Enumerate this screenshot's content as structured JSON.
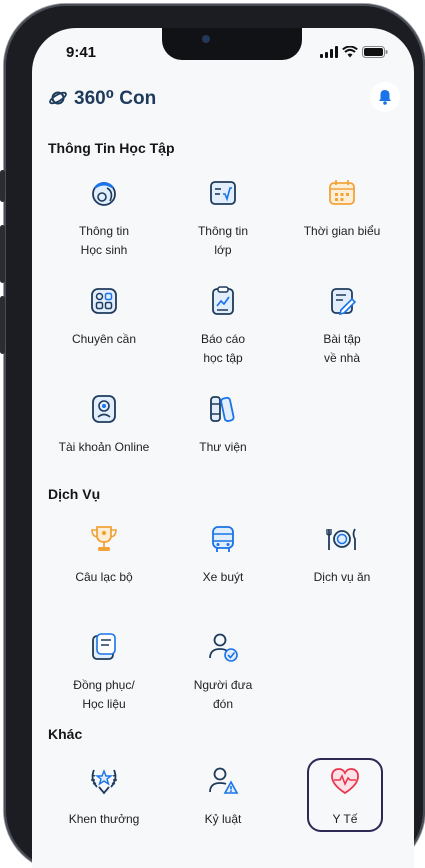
{
  "status_bar": {
    "time": "9:41"
  },
  "header": {
    "title": "360⁰ Con",
    "logo_icon": "planet-icon",
    "notification_icon": "bell-icon"
  },
  "sections": [
    {
      "title": "Thông Tin Học Tập",
      "items": [
        {
          "label": "Thông tin\nHọc sinh",
          "icon": "student-info-icon"
        },
        {
          "label": "Thông tin\nlớp",
          "icon": "class-info-icon"
        },
        {
          "label": "Thời gian biểu",
          "icon": "calendar-icon"
        },
        {
          "label": "Chuyên cần",
          "icon": "attendance-icon"
        },
        {
          "label": "Báo cáo\nhọc tập",
          "icon": "report-icon"
        },
        {
          "label": "Bài tập\nvề nhà",
          "icon": "homework-icon"
        },
        {
          "label": "Tài khoản Online",
          "icon": "online-account-icon"
        },
        {
          "label": "Thư viện",
          "icon": "library-icon"
        }
      ]
    },
    {
      "title": "Dịch Vụ",
      "items": [
        {
          "label": "Câu lạc bộ",
          "icon": "trophy-icon"
        },
        {
          "label": "Xe buýt",
          "icon": "bus-icon"
        },
        {
          "label": "Dịch vụ ăn",
          "icon": "meal-icon"
        },
        {
          "label": "Đồng phục/\nHọc liệu",
          "icon": "uniform-icon"
        },
        {
          "label": "Người đưa\nđón",
          "icon": "pickup-person-icon"
        }
      ]
    },
    {
      "title": "Khác",
      "items": [
        {
          "label": "Khen thưởng",
          "icon": "award-icon"
        },
        {
          "label": "Kỷ luật",
          "icon": "discipline-icon"
        },
        {
          "label": "Y Tế",
          "icon": "health-icon"
        }
      ]
    }
  ],
  "colors": {
    "primary": "#1f3b5c",
    "accent_blue": "#1a73e8",
    "accent_orange": "#f2a33a",
    "health_red": "#e8364f",
    "selected_border": "#2d2854"
  }
}
